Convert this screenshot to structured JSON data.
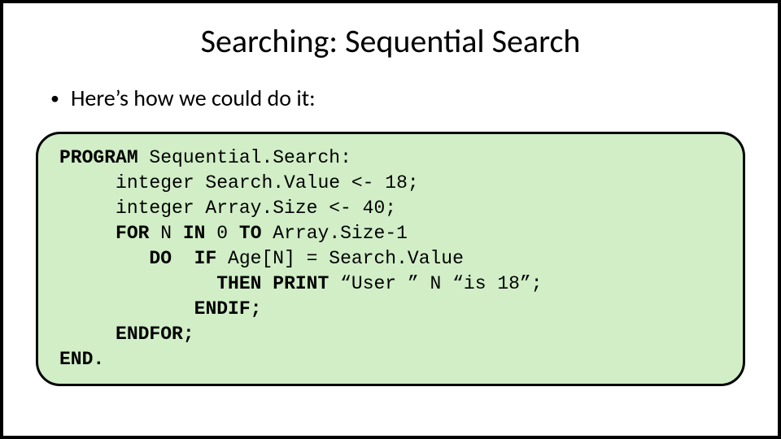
{
  "title": "Searching: Sequential Search",
  "bullet": "Here’s how we could do it:",
  "code": {
    "kw_program": "PROGRAM",
    "prog_name": " Sequential.Search:",
    "line2": "     integer Search.Value <- 18;",
    "line3": "     integer Array.Size <- 40;",
    "l4a": "     ",
    "kw_for": "FOR",
    "l4b": " N ",
    "kw_in": "IN",
    "l4c": " 0 ",
    "kw_to": "TO",
    "l4d": " Array.Size-1",
    "l5a": "        ",
    "kw_do": "DO",
    "l5b": "  ",
    "kw_if": "IF",
    "l5c": " Age[N] = Search.Value",
    "l6a": "              ",
    "kw_then": "THEN",
    "l6b": " ",
    "kw_print": "PRINT",
    "l6c": " “User ” N “is 18”;",
    "l7a": "            ",
    "kw_endif": "ENDIF;",
    "l8a": "     ",
    "kw_endfor": "ENDFOR;",
    "kw_end": "END."
  }
}
